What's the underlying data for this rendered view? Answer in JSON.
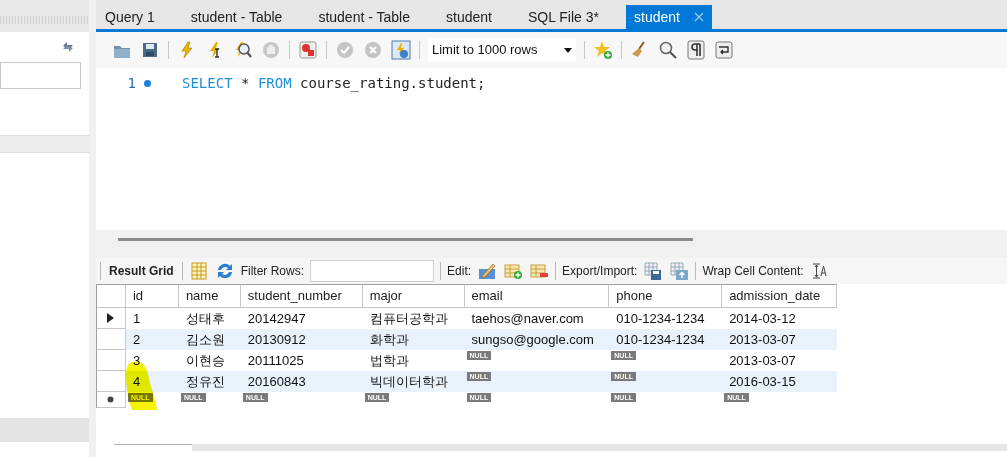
{
  "tabs": [
    {
      "label": "Query 1",
      "selected": false
    },
    {
      "label": "student - Table",
      "selected": false
    },
    {
      "label": "student - Table",
      "selected": false
    },
    {
      "label": "student",
      "selected": false
    },
    {
      "label": "SQL File 3*",
      "selected": false
    },
    {
      "label": "student",
      "selected": true
    }
  ],
  "toolbar": {
    "limit": "Limit to 1000 rows"
  },
  "editor": {
    "lines": [
      {
        "number": "1",
        "tokens": [
          {
            "text": "SELECT",
            "kind": "keyword"
          },
          {
            "text": " * ",
            "kind": "plain"
          },
          {
            "text": "FROM",
            "kind": "keyword"
          },
          {
            "text": " course_rating.student;",
            "kind": "plain"
          }
        ]
      }
    ]
  },
  "result_toolbar": {
    "result_grid": "Result Grid",
    "filter_label": "Filter Rows:",
    "edit_label": "Edit:",
    "export_label": "Export/Import:",
    "wrap_label": "Wrap Cell Content:"
  },
  "grid": {
    "columns": [
      "id",
      "name",
      "student_number",
      "major",
      "email",
      "phone",
      "admission_date"
    ],
    "rows": [
      {
        "current": true,
        "kind": "data",
        "cells": [
          "1",
          "성태후",
          "20142947",
          "컴퓨터공학과",
          "taehos@naver.com",
          "010-1234-1234",
          "2014-03-12"
        ]
      },
      {
        "current": false,
        "kind": "data",
        "cells": [
          "2",
          "김소원",
          "20130912",
          "화학과",
          "sungso@google.com",
          "010-1234-1234",
          "2013-03-07"
        ]
      },
      {
        "current": false,
        "kind": "data",
        "cells": [
          "3",
          "이현승",
          "20111025",
          "법학과",
          {
            "kind": "null",
            "text": "NULL"
          },
          {
            "kind": "null",
            "text": "NULL"
          },
          "2013-03-07"
        ]
      },
      {
        "current": false,
        "kind": "data",
        "cells": [
          "4",
          "정유진",
          "20160843",
          "빅데이터학과",
          {
            "kind": "null",
            "text": "NULL"
          },
          {
            "kind": "null",
            "text": "NULL"
          },
          "2016-03-15"
        ]
      },
      {
        "current": false,
        "kind": "new",
        "cells": [
          {
            "kind": "null",
            "text": "NULL"
          },
          {
            "kind": "null",
            "text": "NULL"
          },
          {
            "kind": "null",
            "text": "NULL"
          },
          {
            "kind": "null",
            "text": "NULL"
          },
          {
            "kind": "null",
            "text": "NULL"
          },
          {
            "kind": "null",
            "text": "NULL"
          },
          {
            "kind": "null",
            "text": "NULL"
          }
        ]
      }
    ]
  }
}
